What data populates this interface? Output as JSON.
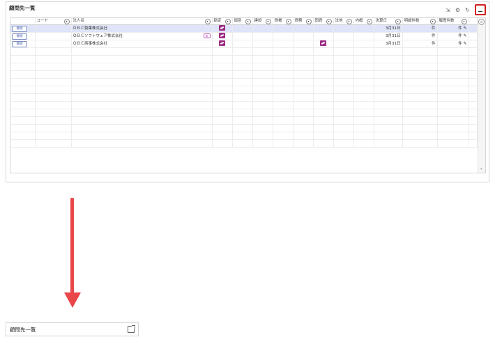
{
  "panel": {
    "title": "顧問先一覧"
  },
  "table": {
    "headers": {
      "connect": "",
      "code": "コード",
      "name": "法人名",
      "kanjo": "勘定",
      "kyuyo": "個別",
      "kensetsu": "建設",
      "saiken": "債権",
      "saimu": "債務",
      "kotei": "固資",
      "hojin": "法地",
      "naibo": "内概",
      "kessan": "決算日",
      "meisai": "明細件数",
      "rireki": "履歴件数"
    },
    "rows": [
      {
        "connect": "接続",
        "code": "",
        "name": "ＯＢＣ製菓株式会社",
        "tag": "",
        "kanjo": true,
        "kotei": false,
        "kessan": "3月31日",
        "meisai": "件",
        "rireki": "件",
        "selected": true
      },
      {
        "connect": "接続",
        "code": "",
        "name": "ＯＢＣソフトウェア株式会社",
        "tag": "拡",
        "kanjo": true,
        "kotei": false,
        "kessan": "3月31日",
        "meisai": "件",
        "rireki": "件",
        "selected": false
      },
      {
        "connect": "接続",
        "code": "",
        "name": "ＯＢＣ商事株式会社",
        "tag": "",
        "kanjo": true,
        "kotei": true,
        "kessan": "3月31日",
        "meisai": "件",
        "rireki": "件",
        "selected": false
      }
    ],
    "empty_rows": 13
  },
  "minimized": {
    "title": "顧問先一覧"
  },
  "colors": {
    "accent": "#9c2c84",
    "highlight": "#d01e1e",
    "arrow": "#e9474a",
    "selected_row": "#dfe4f8"
  },
  "icons": [
    "export-icon",
    "gear-icon",
    "refresh-icon",
    "minimize-icon",
    "pencil-icon",
    "open-external-icon"
  ]
}
